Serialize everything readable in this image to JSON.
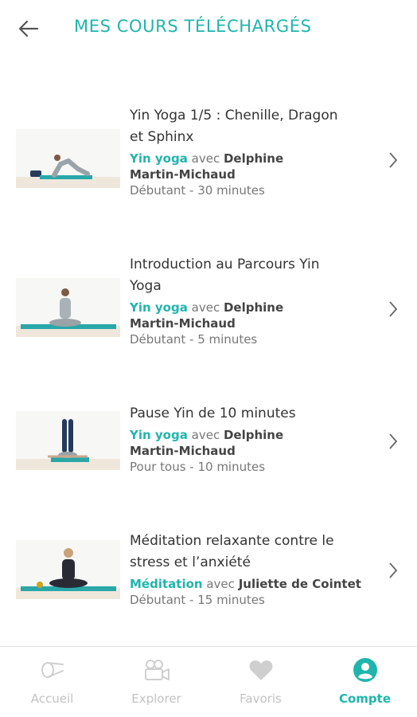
{
  "header": {
    "title": "MES COURS TÉLÉCHARGÉS",
    "back_icon": "arrow-left-icon"
  },
  "courses": [
    {
      "title_line1": "Yin Yoga 1/5 : Chenille, Dragon",
      "title_line2": "et Sphinx",
      "category": "Yin yoga",
      "connector": "avec",
      "teacher_line1": "Delphine",
      "teacher_line2": "Martin-Michaud",
      "level": "Débutant - 30 minutes"
    },
    {
      "title_line1": "Introduction au Parcours Yin",
      "title_line2": "Yoga",
      "category": "Yin yoga",
      "connector": "avec",
      "teacher_line1": "Delphine",
      "teacher_line2": "Martin-Michaud",
      "level": "Débutant - 5 minutes"
    },
    {
      "title_line1": "Pause Yin de 10 minutes",
      "title_line2": "",
      "category": "Yin yoga",
      "connector": "avec",
      "teacher_line1": "Delphine",
      "teacher_line2": "Martin-Michaud",
      "level": "Pour tous - 10 minutes"
    },
    {
      "title_line1": "Méditation relaxante contre le",
      "title_line2": "stress et l’anxiété",
      "category": "Méditation",
      "connector": "avec",
      "teacher_line1": "Juliette de Cointet",
      "teacher_line2": "",
      "level": "Débutant - 15 minutes"
    }
  ],
  "tabbar": {
    "tabs": [
      {
        "label": "Accueil",
        "icon": "yoga-mat-icon",
        "active": false
      },
      {
        "label": "Explorer",
        "icon": "video-camera-icon",
        "active": false
      },
      {
        "label": "Favoris",
        "icon": "heart-icon",
        "active": false
      },
      {
        "label": "Compte",
        "icon": "account-icon",
        "active": true
      }
    ]
  },
  "colors": {
    "accent": "#1fb5ad",
    "text": "#333333",
    "muted": "#777777",
    "inactive_tab": "#c2c2c2",
    "mat": "#2aa7a8"
  }
}
